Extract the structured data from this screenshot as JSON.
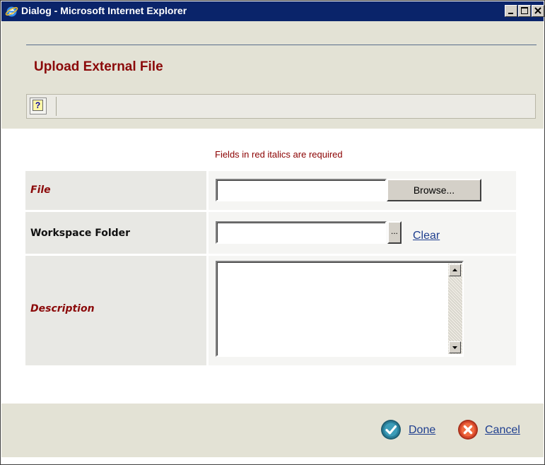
{
  "window": {
    "title": "Dialog - Microsoft Internet Explorer"
  },
  "page": {
    "title": "Upload External File",
    "toolbar": {
      "help_glyph": "?",
      "icons": [
        "help-icon"
      ]
    },
    "required_note": "Fields in red italics are required"
  },
  "form": {
    "file": {
      "label": "File",
      "required": true,
      "value": "",
      "browse_label": "Browse..."
    },
    "folder": {
      "label": "Workspace Folder",
      "required": false,
      "value": "",
      "picker_label": "...",
      "clear_label": "Clear"
    },
    "description": {
      "label": "Description",
      "required": true,
      "value": ""
    }
  },
  "footer": {
    "done_label": "Done",
    "cancel_label": "Cancel",
    "icons": [
      "check-icon",
      "cross-icon"
    ]
  },
  "colors": {
    "title_bar": "#0a246a",
    "accent_red": "#8b0a0a",
    "link_blue": "#1f3f8f",
    "panel": "#e3e2d5",
    "done_teal": "#2a7f9a",
    "cancel_red": "#d9482b"
  }
}
